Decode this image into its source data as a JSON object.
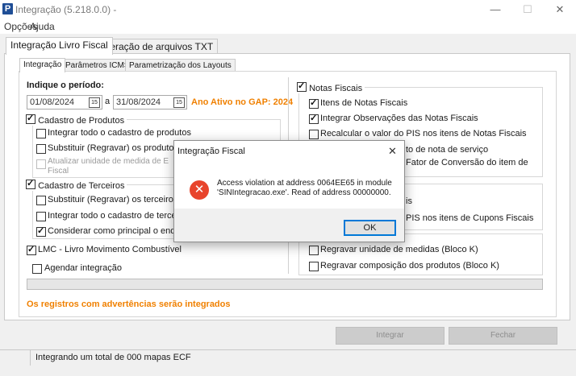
{
  "window": {
    "title": "Integração (5.218.0.0) -",
    "icon_letter": "P",
    "controls": {
      "minimize": "—",
      "maximize": "☐",
      "close": "✕"
    }
  },
  "menu": {
    "items": [
      "Opções",
      "Ajuda"
    ]
  },
  "outer_tabs": [
    "Integração Livro Fiscal",
    "Geração de arquivos TXT"
  ],
  "inner_tabs": [
    "Integração",
    "Parâmetros ICMS",
    "Parametrização dos Layouts"
  ],
  "period": {
    "label": "Indique o período:",
    "start": "01/08/2024",
    "separator": "a",
    "end": "31/08/2024",
    "calendar_icon_text": "15",
    "year_note": "Ano Ativo no GAP: 2024",
    "year_note_color": "#f08000"
  },
  "produtos": {
    "label": "Cadastro de Produtos",
    "checked": true,
    "items": [
      {
        "label": "Integrar todo o cadastro de produtos",
        "checked": false
      },
      {
        "label": "Substituir (Regravar) os produtos",
        "checked": false
      },
      {
        "label": "Atualizar unidade de medida de E",
        "label2": "Fiscal",
        "checked": false,
        "disabled": true
      }
    ]
  },
  "terceiros": {
    "label": "Cadastro de Terceiros",
    "checked": true,
    "items": [
      {
        "label": "Substituir (Regravar) os terceiros",
        "checked": false
      },
      {
        "label": "Integrar todo o cadastro de terceir",
        "checked": false
      },
      {
        "label": "Considerar como principal o ende",
        "checked": true
      }
    ]
  },
  "lmc": {
    "label": "LMC - Livro Movimento Combustível",
    "checked": true
  },
  "agendar": {
    "label": "Agendar integração",
    "checked": false
  },
  "notas": {
    "label": "Notas Fiscais",
    "checked": true,
    "items": [
      {
        "label": "Itens de Notas Fiscais",
        "checked": true
      },
      {
        "label": "Integrar Observações das Notas Fiscais",
        "checked": true
      },
      {
        "label": "Recalcular o valor do PIS nos itens de Notas Fiscais",
        "checked": false
      },
      {
        "label": "to de nota de serviço"
      },
      {
        "label": "Fator de Conversão do item de"
      }
    ]
  },
  "cupons": {
    "items": [
      {
        "label": "is"
      },
      {
        "label": "PIS nos itens de Cupons Fiscais"
      }
    ]
  },
  "blocok": {
    "items": [
      {
        "label": "Regravar unidade de medidas (Bloco K)",
        "checked": false
      },
      {
        "label": "Regravar composição dos produtos (Bloco K)",
        "checked": false
      }
    ]
  },
  "warning": {
    "text": "Os registros com advertências serão integrados",
    "color": "#f08000"
  },
  "buttons": {
    "integrar": "Integrar",
    "fechar": "Fechar"
  },
  "status": {
    "text": "Integrando um total de 000 mapas ECF"
  },
  "dialog": {
    "title": "Integração Fiscal",
    "close": "✕",
    "icon": "✕",
    "line1": "Access violation at address 0064EE65 in module",
    "line2": "'SINIntegracao.exe'. Read of address 00000000.",
    "ok": "OK"
  }
}
